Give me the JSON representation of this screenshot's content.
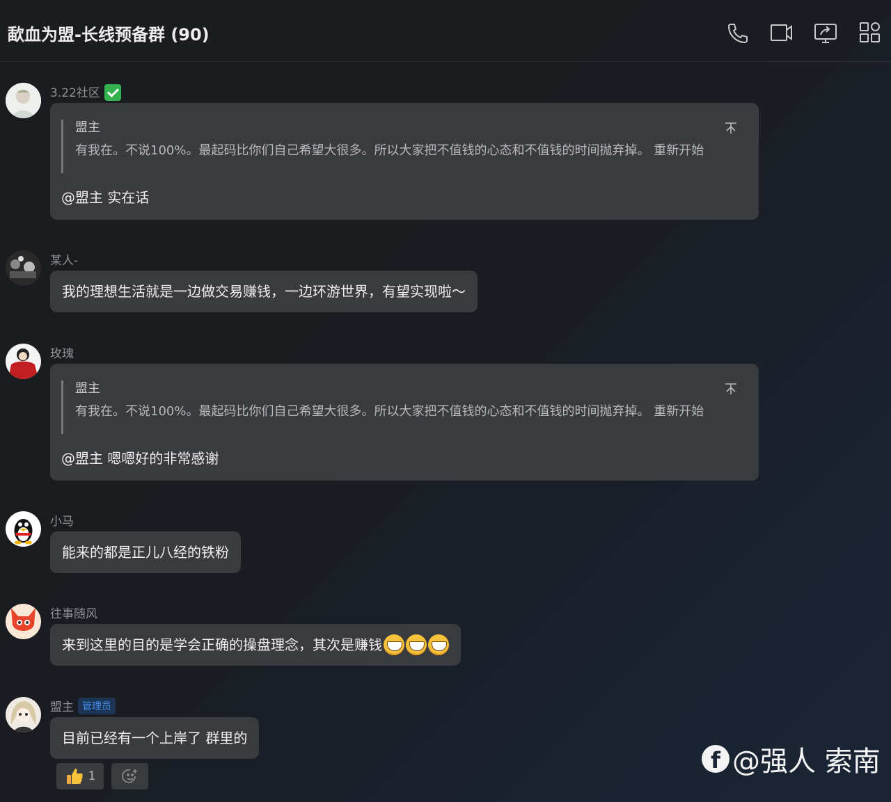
{
  "header": {
    "title": "歃血为盟-长线预备群 (90)",
    "icons": [
      "phone-icon",
      "video-icon",
      "screen-share-icon",
      "apps-icon"
    ]
  },
  "messages": [
    {
      "sender": "3.22社区",
      "quote": {
        "name": "盟主",
        "text": "有我在。不说100%。最起码比你们自己希望大很多。所以大家把不值钱的心态和不值钱的时间抛弃掉。 重新开始"
      },
      "text": "@盟主 实在话"
    },
    {
      "sender": "某人-",
      "text": "我的理想生活就是一边做交易赚钱，一边环游世界，有望实现啦～"
    },
    {
      "sender": "玫瑰",
      "quote": {
        "name": "盟主",
        "text": "有我在。不说100%。最起码比你们自己希望大很多。所以大家把不值钱的心态和不值钱的时间抛弃掉。 重新开始"
      },
      "text": "@盟主 嗯嗯好的非常感谢"
    },
    {
      "sender": "小马",
      "text": "能来的都是正儿八经的铁粉"
    },
    {
      "sender": "往事随风",
      "text": "来到这里的目的是学会正确的操盘理念，其次是赚钱"
    },
    {
      "sender": "盟主",
      "badge": "管理员",
      "text": "目前已经有一个上岸了 群里的",
      "reaction_count": "1"
    }
  ],
  "watermark": "@强人 索南",
  "colors": {
    "bubble": "#3a3b3e",
    "admin_badge": "#3d8ae6",
    "check": "#33b250"
  }
}
